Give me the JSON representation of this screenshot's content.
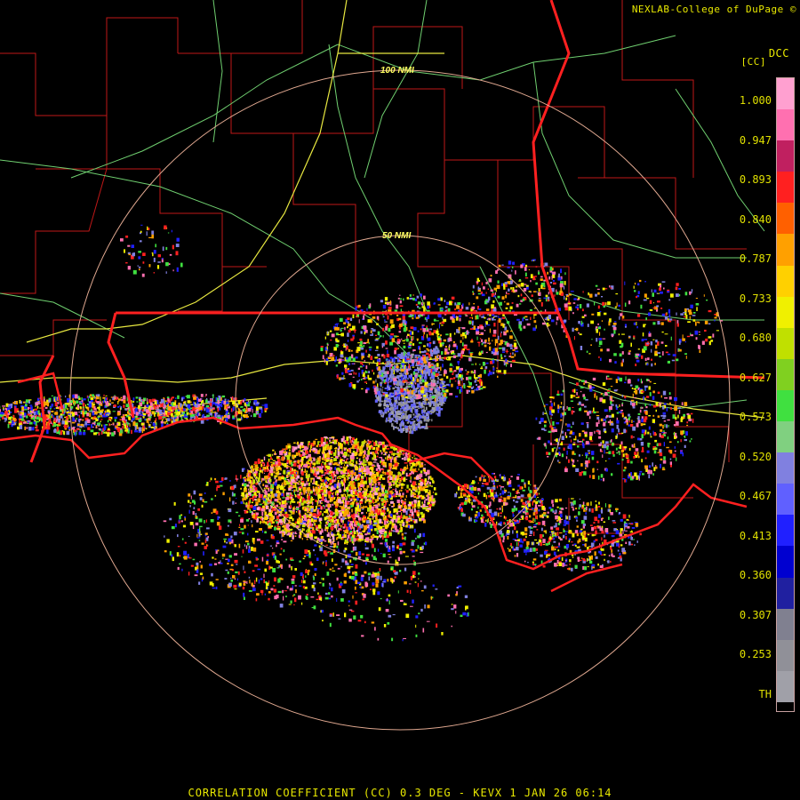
{
  "header": {
    "credit": "NEXLAB-College of DuPage ©",
    "site_code": "DCC",
    "unit": "[CC]"
  },
  "map": {
    "range_rings": [
      {
        "label": "50 NMI"
      },
      {
        "label": "100 NMI"
      }
    ],
    "colors": {
      "state_border": "#ff2020",
      "county_border": "#c01818",
      "highway_major": "#e8e840",
      "highway_minor": "#70d070",
      "range_ring": "#e0a890"
    }
  },
  "legend": {
    "ticks": [
      "1.000",
      "0.947",
      "0.893",
      "0.840",
      "0.787",
      "0.733",
      "0.680",
      "0.627",
      "0.573",
      "0.520",
      "0.467",
      "0.413",
      "0.360",
      "0.307",
      "0.253",
      "TH"
    ],
    "colors": [
      "#ffa0d0",
      "#ff70b0",
      "#c02060",
      "#ff2020",
      "#ff6000",
      "#ffa000",
      "#ffd000",
      "#f0f000",
      "#c0e000",
      "#80d020",
      "#40e040",
      "#80d080",
      "#8080e0",
      "#6060ff",
      "#2020ff",
      "#0000d0",
      "#2020a0",
      "#808090",
      "#909098",
      "#a0a0a8",
      "#000000"
    ]
  },
  "footer": {
    "product": "CORRELATION COEFFICIENT (CC) 0.3 DEG - KEVX 1 JAN 26 06:14"
  }
}
